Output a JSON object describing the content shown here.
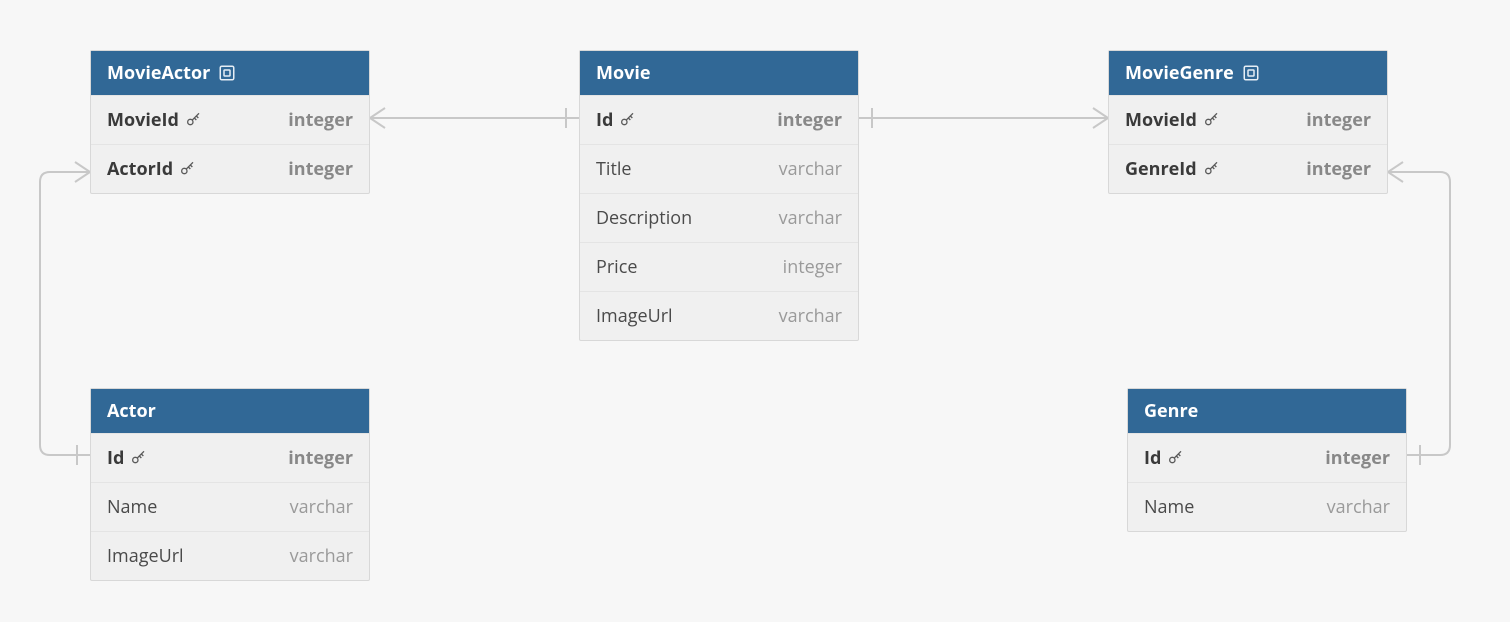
{
  "tables": {
    "movieActor": {
      "title": "MovieActor",
      "isJunction": true,
      "columns": [
        {
          "name": "MovieId",
          "type": "integer",
          "pk": true
        },
        {
          "name": "ActorId",
          "type": "integer",
          "pk": true
        }
      ]
    },
    "movie": {
      "title": "Movie",
      "isJunction": false,
      "columns": [
        {
          "name": "Id",
          "type": "integer",
          "pk": true
        },
        {
          "name": "Title",
          "type": "varchar",
          "pk": false
        },
        {
          "name": "Description",
          "type": "varchar",
          "pk": false
        },
        {
          "name": "Price",
          "type": "integer",
          "pk": false
        },
        {
          "name": "ImageUrl",
          "type": "varchar",
          "pk": false
        }
      ]
    },
    "movieGenre": {
      "title": "MovieGenre",
      "isJunction": true,
      "columns": [
        {
          "name": "MovieId",
          "type": "integer",
          "pk": true
        },
        {
          "name": "GenreId",
          "type": "integer",
          "pk": true
        }
      ]
    },
    "actor": {
      "title": "Actor",
      "isJunction": false,
      "columns": [
        {
          "name": "Id",
          "type": "integer",
          "pk": true
        },
        {
          "name": "Name",
          "type": "varchar",
          "pk": false
        },
        {
          "name": "ImageUrl",
          "type": "varchar",
          "pk": false
        }
      ]
    },
    "genre": {
      "title": "Genre",
      "isJunction": false,
      "columns": [
        {
          "name": "Id",
          "type": "integer",
          "pk": true
        },
        {
          "name": "Name",
          "type": "varchar",
          "pk": false
        }
      ]
    }
  },
  "relationships": [
    {
      "from": "movieActor.MovieId",
      "to": "movie.Id",
      "cardinality": "many-to-one"
    },
    {
      "from": "movieActor.ActorId",
      "to": "actor.Id",
      "cardinality": "many-to-one"
    },
    {
      "from": "movieGenre.MovieId",
      "to": "movie.Id",
      "cardinality": "many-to-one"
    },
    {
      "from": "movieGenre.GenreId",
      "to": "genre.Id",
      "cardinality": "many-to-one"
    }
  ]
}
